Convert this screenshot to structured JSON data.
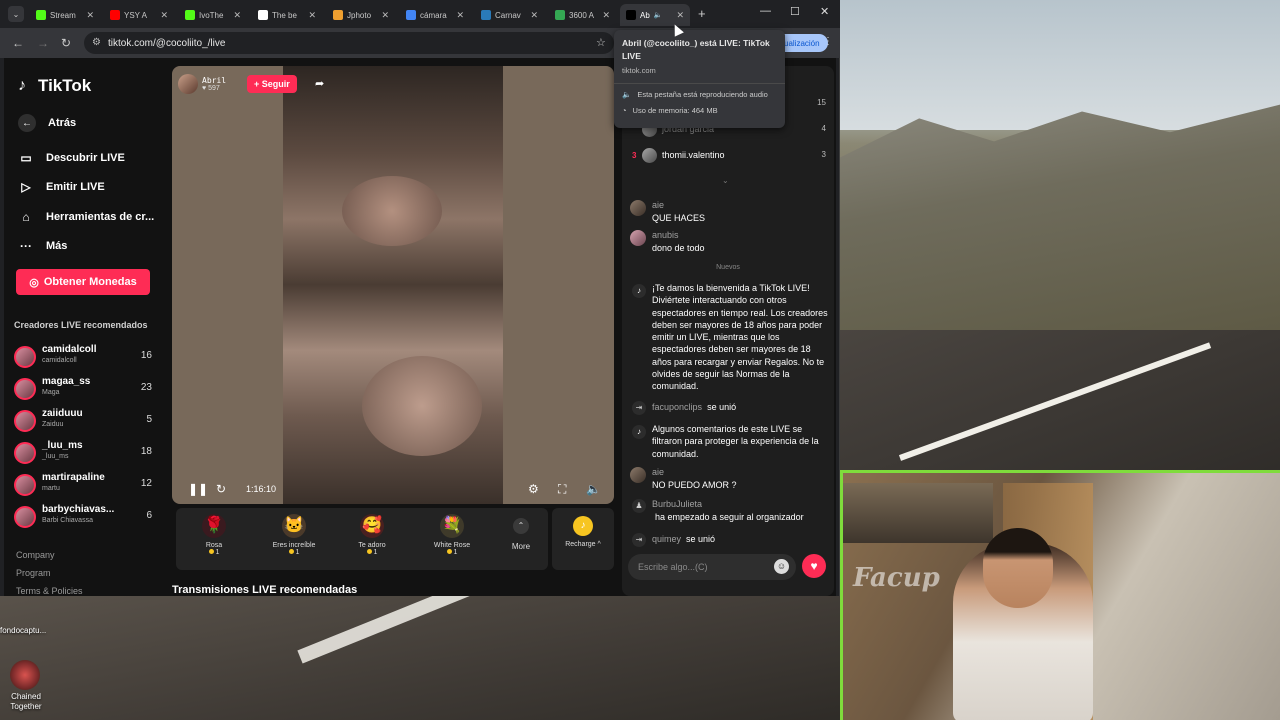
{
  "desktop": {
    "file_label": "fondocaptu...",
    "shortcut_label": "Chained Together",
    "webcam_overlay_text": "Facup"
  },
  "browser": {
    "tabs": [
      {
        "label": "Stream",
        "icon": "kick-icon",
        "color": "#53fc18"
      },
      {
        "label": "YSY A",
        "icon": "youtube-icon",
        "color": "#ff0000"
      },
      {
        "label": "IvoThe",
        "icon": "kick-icon",
        "color": "#53fc18"
      },
      {
        "label": "The be",
        "icon": "diamond-icon",
        "color": "#ffffff"
      },
      {
        "label": "Jphoto",
        "icon": "pen-icon",
        "color": "#f0a030"
      },
      {
        "label": "cámara",
        "icon": "google-icon",
        "color": "#4285f4"
      },
      {
        "label": "Carnav",
        "icon": "kn-icon",
        "color": "#2a7ab8"
      },
      {
        "label": "3600 A",
        "icon": "maps-pin-icon",
        "color": "#34a853"
      },
      {
        "label": "Ab",
        "icon": "tiktok-icon",
        "color": "#000000"
      }
    ],
    "url": "tiktok.com/@cocoliito_/live",
    "update_label": "ualización",
    "tooltip": {
      "title": "Abril (@cocoliito_) está LIVE: TikTok LIVE",
      "domain": "tiktok.com",
      "audio": "Esta pestaña está reproduciendo audio",
      "memory": "Uso de memoria: 464 MB"
    }
  },
  "sidebar": {
    "logo": "TikTok",
    "back": "Atrás",
    "items": [
      {
        "label": "Descubrir LIVE",
        "icon": "tv-icon"
      },
      {
        "label": "Emitir LIVE",
        "icon": "camera-icon"
      },
      {
        "label": "Herramientas de cr...",
        "icon": "home-icon"
      },
      {
        "label": "Más",
        "icon": "more-dots-icon"
      }
    ],
    "coins_button": "Obtener Monedas",
    "recommended_title": "Creadores LIVE recomendados",
    "creators": [
      {
        "name": "camidalcoll",
        "sub": "camidalcoll",
        "count": "16"
      },
      {
        "name": "magaa_ss",
        "sub": "Maga",
        "count": "23"
      },
      {
        "name": "zaiiduuu",
        "sub": "Zaiduu",
        "count": "5"
      },
      {
        "name": "_luu_ms",
        "sub": "_luu_ms",
        "count": "18"
      },
      {
        "name": "martirapaline",
        "sub": "martu",
        "count": "12"
      },
      {
        "name": "barbychiavas...",
        "sub": "Barbi Chiavassa",
        "count": "6"
      }
    ],
    "footer": [
      "Company",
      "Program",
      "Terms & Policies"
    ]
  },
  "video": {
    "host_name": "Abril",
    "host_likes": "597",
    "follow_label": "+ Seguir",
    "time": "1:16:10"
  },
  "gifts": [
    {
      "name": "Rosa",
      "price": "1",
      "icon": "🌹"
    },
    {
      "name": "Eres increíble",
      "price": "1",
      "icon": "🐱"
    },
    {
      "name": "Te adoro",
      "price": "1",
      "icon": "🥰"
    },
    {
      "name": "White Rose",
      "price": "1",
      "icon": "💐"
    }
  ],
  "more_label": "More",
  "recharge_label": "Recharge ^",
  "recommended_streams": "Transmisiones LIVE recomendadas",
  "chat": {
    "ranking": [
      {
        "rank": "",
        "name": "",
        "score": "15"
      },
      {
        "rank": "",
        "name": "jordan garcia",
        "score": "4"
      },
      {
        "rank": "3",
        "name": "thomii.valentino",
        "score": "3"
      }
    ],
    "messages_top": [
      {
        "user": "aie",
        "text": "QUE HACES"
      },
      {
        "user": "anubis",
        "text": "dono de todo"
      }
    ],
    "new_divider": "Nuevos",
    "welcome": "¡Te damos la bienvenida a TikTok LIVE! Diviértete interactuando con otros espectadores en tiempo real. Los creadores deben ser mayores de 18 años para poder emitir un LIVE, mientras que los espectadores deben ser mayores de 18 años para recargar y enviar Regalos. No te olvides de seguir las Normas de la comunidad.",
    "join1": {
      "user": "facuponclips",
      "text": "se unió"
    },
    "filtered": "Algunos comentarios de este LIVE se filtraron para proteger la experiencia de la comunidad.",
    "msg_aie2": {
      "user": "aie",
      "text": "NO PUEDO AMOR ?"
    },
    "follow_msg": {
      "user": "BurbuJulieta",
      "text": "ha empezado a seguir al organizador"
    },
    "join2": {
      "user": "quimey",
      "text": "se unió"
    },
    "input_placeholder": "Escribe algo...(C)"
  }
}
